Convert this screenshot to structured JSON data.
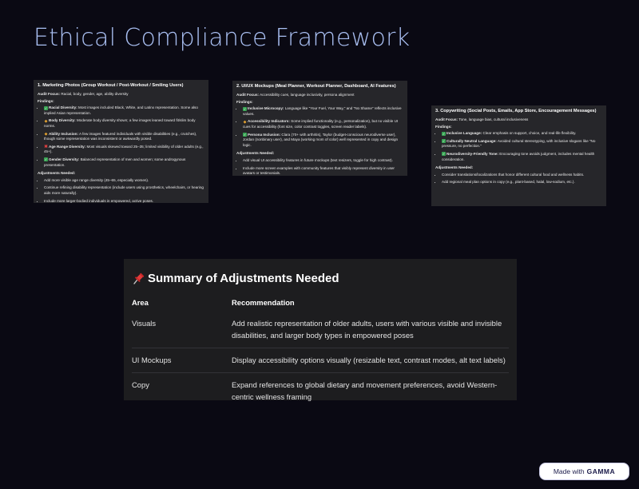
{
  "page": {
    "title": "Ethical Compliance Framework"
  },
  "card1": {
    "title": "1. Marketing Photos (Group Workout / Post-Workout / Smiling Users)",
    "audit_label": "Audit Focus:",
    "audit_value": " Racial, body, gender, age, ability diversity",
    "findings_label": "Findings:",
    "findings": [
      {
        "icon": "check",
        "label": "Racial Diversity:",
        "text": " Most images included Black, White, and Latinx representation. Some also implied Asian representation."
      },
      {
        "icon": "warn",
        "label": "Body Diversity:",
        "text": " Moderate body diversity shown; a few images leaned toward fit/slim body norms."
      },
      {
        "icon": "warn",
        "label": "Ability Inclusion:",
        "text": " A few images featured individuals with visible disabilities (e.g., crutches), though some representation was inconsistent or awkwardly posed."
      },
      {
        "icon": "cross",
        "label": "Age Range Diversity:",
        "text": " Most visuals skewed toward 25–35; limited visibility of older adults (e.g., 45+)."
      },
      {
        "icon": "check",
        "label": "Gender Diversity:",
        "text": " Balanced representation of men and women; some androgynous presentation."
      }
    ],
    "adjust_label": "Adjustments Needed:",
    "adjustments": [
      "Add more visible age range diversity (45–65, especially women).",
      "Continue refining disability representation (include users using prosthetics, wheelchairs, or hearing aids more naturally).",
      "Include more larger-bodied individuals in empowered, active poses."
    ]
  },
  "card2": {
    "title": "2. UI/UX Mockups (Meal Planner, Workout Planner, Dashboard, AI Features)",
    "audit_label": "Audit Focus:",
    "audit_value": " Accessibility cues, language inclusivity, persona alignment",
    "findings_label": "Findings:",
    "findings": [
      {
        "icon": "check",
        "label": "Inclusive Microcopy:",
        "text": " Language like \"Your Fuel, Your Way,\" and \"No Shame\" reflects inclusive values."
      },
      {
        "icon": "warn",
        "label": "Accessibility Indicators:",
        "text": " Some implied functionality (e.g., personalization), but no visible UI cues for accessibility (font size, color contrast toggles, screen reader labels)."
      },
      {
        "icon": "check",
        "label": "Persona Inclusion:",
        "text": " Clara (70+ with arthritis), Taylor (budget-conscious neurodiverse user), Jordan (nonbinary user), and Maya (working mom of color) well represented in copy and design logic."
      }
    ],
    "adjust_label": "Adjustments Needed:",
    "adjustments": [
      "Add visual UI accessibility features in future mockups (text resizers, toggle for high contrast).",
      "Include more screen examples with community features that visibly represent diversity in user avatars or testimonials."
    ]
  },
  "card3": {
    "title": "3. Copywriting (Social Posts, Emails, App Store, Encouragement Messages)",
    "audit_label": "Audit Focus:",
    "audit_value": " Tone, language bias, cultural inclusiveness",
    "findings_label": "Findings:",
    "findings": [
      {
        "icon": "check",
        "label": "Inclusive Language:",
        "text": " Clear emphasis on support, choice, and real-life flexibility."
      },
      {
        "icon": "check",
        "label": "Culturally Neutral Language:",
        "text": " Avoided cultural stereotyping, with inclusive slogans like \"No pressure, no perfection.\""
      },
      {
        "icon": "check",
        "label": "Neurodiversity-Friendly Tone:",
        "text": " Encouraging tone avoids judgment, includes mental health consideration."
      }
    ],
    "adjust_label": "Adjustments Needed:",
    "adjustments": [
      "Consider translations/localizations that honor different cultural food and wellness habits.",
      "Add regional meal plan options in copy (e.g., plant-based, halal, low-sodium, etc.)."
    ]
  },
  "summary": {
    "title": "Summary of Adjustments Needed",
    "headers": [
      "Area",
      "Recommendation"
    ],
    "rows": [
      {
        "area": "Visuals",
        "recommendation": "Add realistic representation of older adults, users with various visible and invisible disabilities, and larger body types in empowered poses"
      },
      {
        "area": "UI Mockups",
        "recommendation": "Display accessibility options visually (resizable text, contrast modes, alt text labels)"
      },
      {
        "area": "Copy",
        "recommendation": "Expand references to global dietary and movement preferences, avoid Western-centric wellness framing"
      }
    ]
  },
  "badge": {
    "prefix": "Made with",
    "brand": "GAMMA"
  }
}
